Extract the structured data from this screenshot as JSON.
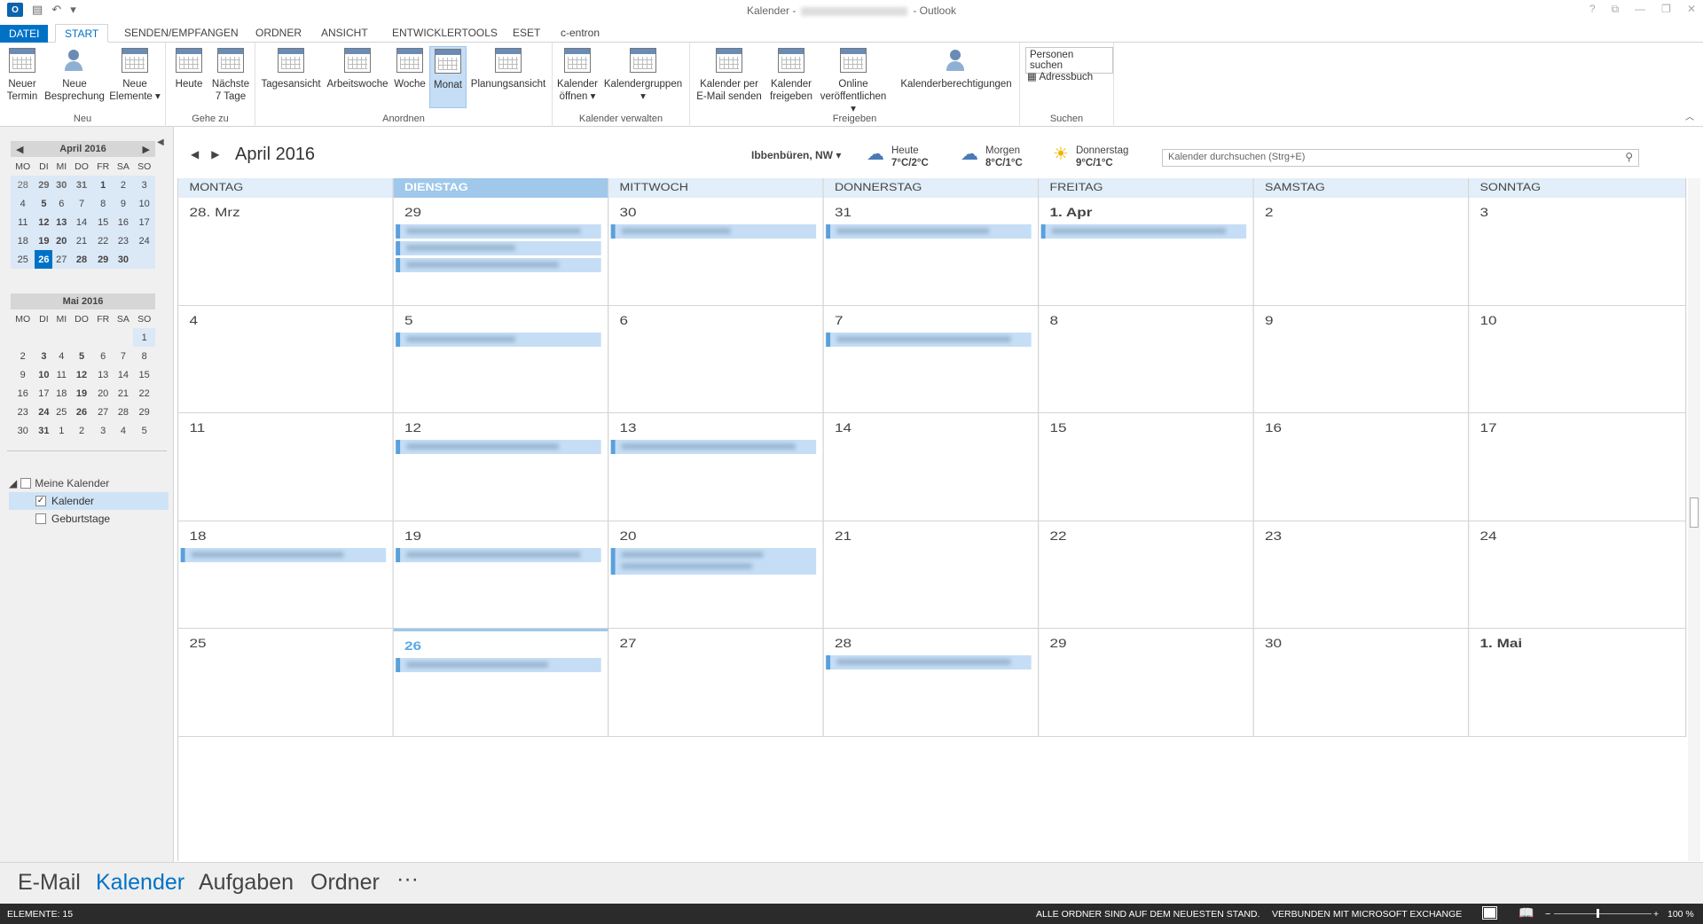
{
  "window": {
    "title_left": "Kalender -",
    "title_right": "- Outlook"
  },
  "tabs": [
    {
      "label": "DATEI"
    },
    {
      "label": "START"
    },
    {
      "label": "SENDEN/EMPFANGEN"
    },
    {
      "label": "ORDNER"
    },
    {
      "label": "ANSICHT"
    },
    {
      "label": "ENTWICKLERTOOLS"
    },
    {
      "label": "ESET"
    },
    {
      "label": "c-entron"
    }
  ],
  "ribbon": {
    "groups": {
      "neu": "Neu",
      "gehezu": "Gehe zu",
      "anordnen": "Anordnen",
      "verwalten": "Kalender verwalten",
      "freigeben": "Freigeben",
      "suchen": "Suchen"
    },
    "buttons": {
      "neuer_termin": "Neuer\nTermin",
      "neue_besprechung": "Neue\nBesprechung",
      "neue_elemente": "Neue\nElemente ▾",
      "heute": "Heute",
      "naechste7": "Nächste\n7 Tage",
      "tagesansicht": "Tagesansicht",
      "arbeitswoche": "Arbeitswoche",
      "woche": "Woche",
      "monat": "Monat",
      "planungsansicht": "Planungsansicht",
      "kalender_oeffnen": "Kalender\nöffnen ▾",
      "kalendergruppen": "Kalendergruppen\n▾",
      "per_email": "Kalender per\nE-Mail senden",
      "freigeben": "Kalender\nfreigeben",
      "online": "Online\nveröffentlichen ▾",
      "berechtigungen": "Kalenderberechtigungen",
      "personen_suchen": "Personen suchen",
      "adressbuch": "Adressbuch"
    }
  },
  "minicals": [
    {
      "title": "April 2016",
      "weekdays": [
        "MO",
        "DI",
        "MI",
        "DO",
        "FR",
        "SA",
        "SO"
      ],
      "weeks": [
        [
          "28",
          "29",
          "30",
          "31",
          "1",
          "2",
          "3"
        ],
        [
          "4",
          "5",
          "6",
          "7",
          "8",
          "9",
          "10"
        ],
        [
          "11",
          "12",
          "13",
          "14",
          "15",
          "16",
          "17"
        ],
        [
          "18",
          "19",
          "20",
          "21",
          "22",
          "23",
          "24"
        ],
        [
          "25",
          "26",
          "27",
          "28",
          "29",
          "30",
          ""
        ]
      ]
    },
    {
      "title": "Mai 2016",
      "weekdays": [
        "MO",
        "DI",
        "MI",
        "DO",
        "FR",
        "SA",
        "SO"
      ],
      "weeks": [
        [
          "",
          "",
          "",
          "",
          "",
          "",
          "1"
        ],
        [
          "2",
          "3",
          "4",
          "5",
          "6",
          "7",
          "8"
        ],
        [
          "9",
          "10",
          "11",
          "12",
          "13",
          "14",
          "15"
        ],
        [
          "16",
          "17",
          "18",
          "19",
          "20",
          "21",
          "22"
        ],
        [
          "23",
          "24",
          "25",
          "26",
          "27",
          "28",
          "29"
        ],
        [
          "30",
          "31",
          "1",
          "2",
          "3",
          "4",
          "5"
        ]
      ]
    }
  ],
  "calendars": {
    "group": "Meine Kalender",
    "items": [
      {
        "label": "Kalender",
        "checked": true
      },
      {
        "label": "Geburtstage",
        "checked": false
      }
    ]
  },
  "calendar": {
    "month_title": "April 2016",
    "location": "Ibbenbüren, NW",
    "weather": [
      {
        "day": "Heute",
        "temp": "7°C/2°C",
        "icon": "rain-cloud-icon"
      },
      {
        "day": "Morgen",
        "temp": "8°C/1°C",
        "icon": "snow-cloud-icon"
      },
      {
        "day": "Donnerstag",
        "temp": "9°C/1°C",
        "icon": "sun-cloud-icon"
      }
    ],
    "search_placeholder": "Kalender durchsuchen (Strg+E)",
    "weekdays": [
      "MONTAG",
      "DIENSTAG",
      "MITTWOCH",
      "DONNERSTAG",
      "FREITAG",
      "SAMSTAG",
      "SONNTAG"
    ],
    "current_weekday_index": 1,
    "weeks": [
      [
        {
          "d": "28. Mrz",
          "ev": 0
        },
        {
          "d": "29",
          "ev": 3
        },
        {
          "d": "30",
          "ev": 1
        },
        {
          "d": "31",
          "ev": 1
        },
        {
          "d": "1. Apr",
          "ev": 1,
          "bold": true
        },
        {
          "d": "2",
          "ev": 0
        },
        {
          "d": "3",
          "ev": 0
        }
      ],
      [
        {
          "d": "4",
          "ev": 0
        },
        {
          "d": "5",
          "ev": 1
        },
        {
          "d": "6",
          "ev": 0
        },
        {
          "d": "7",
          "ev": 1
        },
        {
          "d": "8",
          "ev": 0
        },
        {
          "d": "9",
          "ev": 0
        },
        {
          "d": "10",
          "ev": 0
        }
      ],
      [
        {
          "d": "11",
          "ev": 0
        },
        {
          "d": "12",
          "ev": 1
        },
        {
          "d": "13",
          "ev": 1
        },
        {
          "d": "14",
          "ev": 0
        },
        {
          "d": "15",
          "ev": 0
        },
        {
          "d": "16",
          "ev": 0
        },
        {
          "d": "17",
          "ev": 0
        }
      ],
      [
        {
          "d": "18",
          "ev": 1
        },
        {
          "d": "19",
          "ev": 1
        },
        {
          "d": "20",
          "ev": 1,
          "tall": true
        },
        {
          "d": "21",
          "ev": 0
        },
        {
          "d": "22",
          "ev": 0
        },
        {
          "d": "23",
          "ev": 0
        },
        {
          "d": "24",
          "ev": 0
        }
      ],
      [
        {
          "d": "25",
          "ev": 0
        },
        {
          "d": "26",
          "ev": 1,
          "today": true
        },
        {
          "d": "27",
          "ev": 0
        },
        {
          "d": "28",
          "ev": 1
        },
        {
          "d": "29",
          "ev": 0
        },
        {
          "d": "30",
          "ev": 0
        },
        {
          "d": "1. Mai",
          "ev": 0,
          "bold": true
        }
      ]
    ]
  },
  "bottom_nav": [
    {
      "label": "E-Mail",
      "active": false
    },
    {
      "label": "Kalender",
      "active": true
    },
    {
      "label": "Aufgaben",
      "active": false
    },
    {
      "label": "Ordner",
      "active": false
    },
    {
      "label": "···",
      "active": false
    }
  ],
  "status": {
    "items": "ELEMENTE: 15",
    "sync": "ALLE ORDNER SIND AUF DEM NEUESTEN STAND.",
    "connection": "VERBUNDEN MIT MICROSOFT EXCHANGE",
    "zoom": "100 %"
  },
  "colors": {
    "accent": "#0072c6",
    "event_fill": "#c5def5",
    "event_border": "#5aa0dc",
    "header_bg": "#e2eef9"
  }
}
